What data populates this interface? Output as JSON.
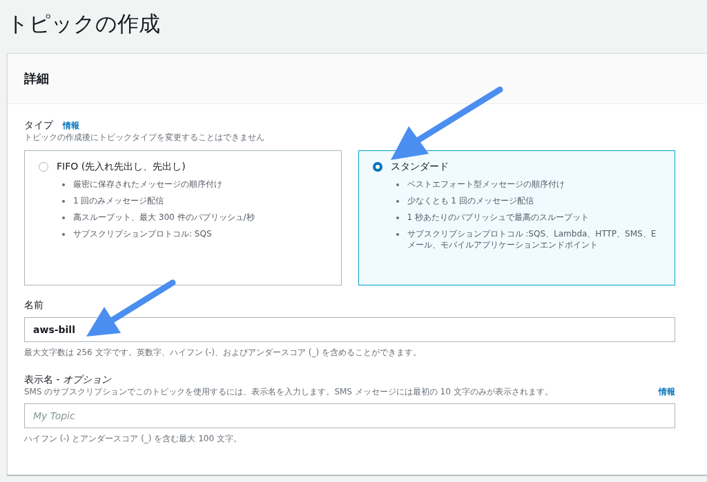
{
  "page_title": "トピックの作成",
  "panel": {
    "title": "詳細",
    "type_field": {
      "label": "タイプ",
      "info_link": "情報",
      "description": "トピックの作成後にトピックタイプを変更することはできません",
      "options": [
        {
          "label": "FIFO (先入れ先出し、先出し)",
          "selected": false,
          "bullets": [
            "厳密に保存されたメッセージの順序付け",
            "1 回のみメッセージ配信",
            "高スループット、最大 300 件のパブリッシュ/秒",
            "サブスクリプションプロトコル: SQS"
          ]
        },
        {
          "label": "スタンダード",
          "selected": true,
          "bullets": [
            "ベストエフォート型メッセージの順序付け",
            "少なくとも 1 回のメッセージ配信",
            "1 秒あたりのパブリッシュで最高のスループット",
            "サブスクリプションプロトコル :SQS、Lambda、HTTP、SMS、E メール、モバイルアプリケーションエンドポイント"
          ]
        }
      ]
    },
    "name_field": {
      "label": "名前",
      "value": "aws-bill",
      "hint": "最大文字数は 256 文字です。英数字、ハイフン (-)、およびアンダースコア (_) を含めることができます。"
    },
    "display_name_field": {
      "label": "表示名 - *オプション*",
      "description": "SMS のサブスクリプションでこのトピックを使用するには、表示名を入力します。SMS メッセージには最初の 10 文字のみが表示されます。",
      "info_link": "情報",
      "placeholder": "My Topic",
      "hint": "ハイフン (-) とアンダースコア (_) を含む最大 100 文字。"
    }
  }
}
